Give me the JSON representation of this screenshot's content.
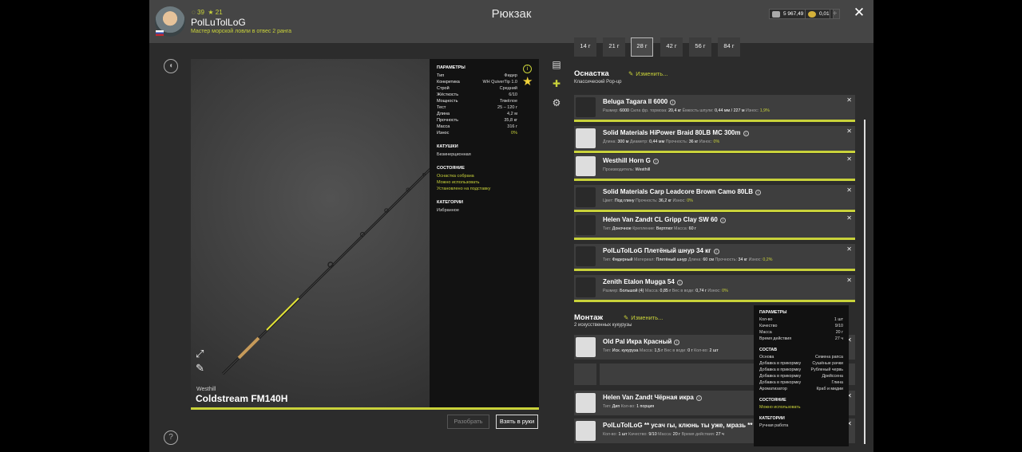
{
  "header": {
    "stat_coins": "39",
    "stat_level": "21",
    "username": "PolLuTolLoG",
    "user_title": "Мастер морской ловли в отвес 2 ранга",
    "title": "Рюкзак",
    "silver": "5 967,49",
    "gold": "0,01",
    "plus": "+",
    "close": "✕"
  },
  "rod": {
    "brand": "Westhill",
    "name": "Coldstream FM140H",
    "params_title": "ПАРАМЕТРЫ",
    "params": [
      {
        "k": "Тип",
        "v": "Фидер"
      },
      {
        "k": "Конкретика",
        "v": "WH QuiverTip 1.0"
      },
      {
        "k": "Строй",
        "v": "Средний"
      },
      {
        "k": "Жёсткость",
        "v": "6/10"
      },
      {
        "k": "Мощность",
        "v": "Тяжёлое"
      },
      {
        "k": "Тест",
        "v": "25 – 120 г"
      },
      {
        "k": "Длина",
        "v": "4,2 м"
      },
      {
        "k": "Прочность",
        "v": "35,8 кг"
      },
      {
        "k": "Масса",
        "v": "316 г"
      },
      {
        "k": "Износ",
        "v": "0%"
      }
    ],
    "reels_title": "КАТУШКИ",
    "reels_value": "Безинерционная",
    "state_title": "СОСТОЯНИЕ",
    "state": [
      "Оснастка собрана",
      "Можно использовать",
      "Установлено на подставку"
    ],
    "cat_title": "КАТЕГОРИИ",
    "cat_value": "Избранное",
    "btn_disassemble": "Разобрать",
    "btn_take": "Взять в руки"
  },
  "chips": [
    "14 г",
    "21 г",
    "28 г",
    "42 г",
    "56 г",
    "84 г"
  ],
  "tackle": {
    "title": "Оснастка",
    "subtitle": "Классический Pop-up",
    "edit": "Изменить...",
    "items": [
      {
        "name": "Beluga Tagara II 6000",
        "meta": [
          [
            "Размер",
            "6000"
          ],
          [
            "Сила фр. тормоза",
            "20,4 кг"
          ],
          [
            "Ёмкость шпули",
            "0,44 мм / 227 м"
          ],
          [
            "Износ",
            "1,9%"
          ]
        ]
      },
      {
        "name": "Solid Materials HiPower Braid 80LB MC 300m",
        "meta": [
          [
            "Длина",
            "300 м"
          ],
          [
            "Диаметр",
            "0,44 мм"
          ],
          [
            "Прочность",
            "36 кг"
          ],
          [
            "Износ",
            "0%"
          ]
        ]
      },
      {
        "name": "Westhill Horn G",
        "meta": [
          [
            "Производитель",
            "Westhill"
          ]
        ]
      },
      {
        "name": "Solid Materials Carp Leadcore Brown Camo 80LB",
        "meta": [
          [
            "Цвет",
            "Под глину"
          ],
          [
            "Прочность",
            "36,2 кг"
          ],
          [
            "Износ",
            "0%"
          ]
        ]
      },
      {
        "name": "Helen Van Zandt CL Gripp Clay SW 60",
        "meta": [
          [
            "Тип",
            "Доночное"
          ],
          [
            "Крепление",
            "Вертлюг"
          ],
          [
            "Масса",
            "60 г"
          ]
        ]
      },
      {
        "name": "PolLuTolLoG Плетёный шнур 34 кг",
        "meta": [
          [
            "Тип",
            "Фидерный"
          ],
          [
            "Материал",
            "Плетёный шнур"
          ],
          [
            "Длина",
            "60 см"
          ],
          [
            "Прочность",
            "34 кг"
          ],
          [
            "Износ",
            "0,2%"
          ]
        ]
      },
      {
        "name": "Zenith Etalon Mugga 54",
        "meta": [
          [
            "Размер",
            "Большой (4)"
          ],
          [
            "Масса",
            "0,85 г"
          ],
          [
            "Вес в воде",
            "0,74 г"
          ],
          [
            "Износ",
            "0%"
          ]
        ]
      }
    ]
  },
  "rig": {
    "title": "Монтаж",
    "subtitle": "2 искусственных кукурузы",
    "edit": "Изменить...",
    "items": [
      {
        "name": "Old Pal Икра Красный",
        "meta": [
          [
            "Тип",
            "Иск. кукуруза"
          ],
          [
            "Масса",
            "1,5 г"
          ],
          [
            "Вес в воде",
            "0 г"
          ],
          [
            "Кол-во",
            "2 шт"
          ]
        ]
      },
      {
        "name": "Helen Van Zandt Чёрная икра",
        "meta": [
          [
            "Тип",
            "Дип"
          ],
          [
            "Кол-во",
            "1 порция"
          ]
        ]
      },
      {
        "name": "PolLuTolLoG ** усач гы, клюнь ты уже, мразь **",
        "meta": [
          [
            "Кол-во",
            "1 шт"
          ],
          [
            "Качество",
            "9/10"
          ],
          [
            "Масса",
            "20 г"
          ],
          [
            "Время действия",
            "27 ч"
          ]
        ]
      }
    ]
  },
  "tooltip": {
    "params_title": "ПАРАМЕТРЫ",
    "params": [
      [
        "Кол-во",
        "1 шт"
      ],
      [
        "Качество",
        "9/10"
      ],
      [
        "Масса",
        "20 г"
      ],
      [
        "Время действия",
        "27 ч"
      ]
    ],
    "comp_title": "СОСТАВ",
    "comp": [
      [
        "Основа",
        "Семена рапса"
      ],
      [
        "Добавка в прикормку",
        "Сушёные рачки"
      ],
      [
        "Добавка в прикормку",
        "Рубленый червь"
      ],
      [
        "Добавка в прикормку",
        "Дрейссена"
      ],
      [
        "Добавка в прикормку",
        "Глина"
      ],
      [
        "Ароматизатор",
        "Краб и мидии"
      ]
    ],
    "state_title": "СОСТОЯНИЕ",
    "state": "Можно использовать",
    "cat_title": "КАТЕГОРИИ",
    "cat": "Ручная работа"
  },
  "colors": {
    "accent": "#c9d23a",
    "panel": "#3e3e3e",
    "background": "#2c2c2c"
  }
}
